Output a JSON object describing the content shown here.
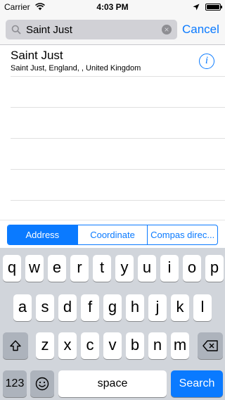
{
  "status_bar": {
    "carrier": "Carrier",
    "time": "4:03 PM",
    "wifi_icon": "wifi-icon",
    "location_icon": "location-arrow-icon",
    "battery_icon": "battery-icon"
  },
  "search": {
    "value": "Saint Just",
    "cancel_label": "Cancel",
    "search_icon": "search-icon",
    "clear_icon": "clear-icon",
    "clear_glyph": "×"
  },
  "results": [
    {
      "title": "Saint Just",
      "subtitle": "Saint Just, England, , United Kingdom",
      "info_glyph": "i"
    }
  ],
  "segments": {
    "items": [
      "Address",
      "Coordinate",
      "Compas direc..."
    ],
    "selected": "Address"
  },
  "keyboard": {
    "row1": [
      "q",
      "w",
      "e",
      "r",
      "t",
      "y",
      "u",
      "i",
      "o",
      "p"
    ],
    "row2": [
      "a",
      "s",
      "d",
      "f",
      "g",
      "h",
      "j",
      "k",
      "l"
    ],
    "row3": [
      "z",
      "x",
      "c",
      "v",
      "b",
      "n",
      "m"
    ],
    "shift_icon": "shift-icon",
    "delete_icon": "delete-icon",
    "numbers_label": "123",
    "emoji_icon": "emoji-icon",
    "space_label": "space",
    "search_label": "Search"
  },
  "colors": {
    "accent": "#0a7aff",
    "keyboard_bg": "#d1d5db",
    "special_key": "#adb3bc"
  }
}
